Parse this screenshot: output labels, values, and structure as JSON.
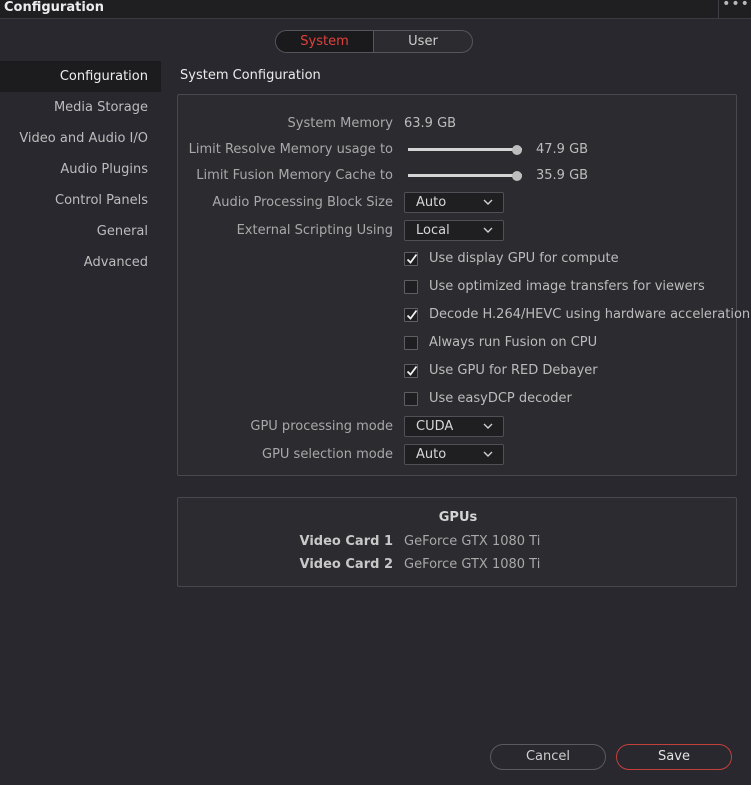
{
  "window": {
    "title": "Configuration",
    "menu_glyph": "•••"
  },
  "mode_toggle": {
    "system": "System",
    "user": "User",
    "active": "System"
  },
  "sidebar": {
    "items": [
      {
        "label": "Configuration",
        "active": true
      },
      {
        "label": "Media Storage"
      },
      {
        "label": "Video and Audio I/O"
      },
      {
        "label": "Audio Plugins"
      },
      {
        "label": "Control Panels"
      },
      {
        "label": "General"
      },
      {
        "label": "Advanced"
      }
    ]
  },
  "system_configuration": {
    "title": "System Configuration",
    "system_memory": {
      "label": "System Memory",
      "value": "63.9 GB"
    },
    "resolve_memory": {
      "label": "Limit Resolve Memory usage to",
      "value": "47.9 GB",
      "fraction": 1.0
    },
    "fusion_cache": {
      "label": "Limit Fusion Memory Cache to",
      "value": "35.9 GB",
      "fraction": 1.0
    },
    "audio_block_size": {
      "label": "Audio Processing Block Size",
      "value": "Auto"
    },
    "external_scripting": {
      "label": "External Scripting Using",
      "value": "Local"
    },
    "checkboxes": [
      {
        "label": "Use display GPU for compute",
        "checked": true
      },
      {
        "label": "Use optimized image transfers for viewers",
        "checked": false
      },
      {
        "label": "Decode H.264/HEVC using hardware acceleration",
        "checked": true
      },
      {
        "label": "Always run Fusion on CPU",
        "checked": false
      },
      {
        "label": "Use GPU for RED Debayer",
        "checked": true
      },
      {
        "label": "Use easyDCP decoder",
        "checked": false
      }
    ],
    "gpu_processing_mode": {
      "label": "GPU processing mode",
      "value": "CUDA"
    },
    "gpu_selection_mode": {
      "label": "GPU selection mode",
      "value": "Auto"
    }
  },
  "gpus": {
    "title": "GPUs",
    "cards": [
      {
        "label": "Video Card 1",
        "value": "GeForce GTX 1080 Ti"
      },
      {
        "label": "Video Card 2",
        "value": "GeForce GTX 1080 Ti"
      }
    ]
  },
  "footer": {
    "cancel": "Cancel",
    "save": "Save"
  },
  "colors": {
    "accent": "#e0413b",
    "background": "#28282e",
    "panel": "#2b2b30"
  }
}
